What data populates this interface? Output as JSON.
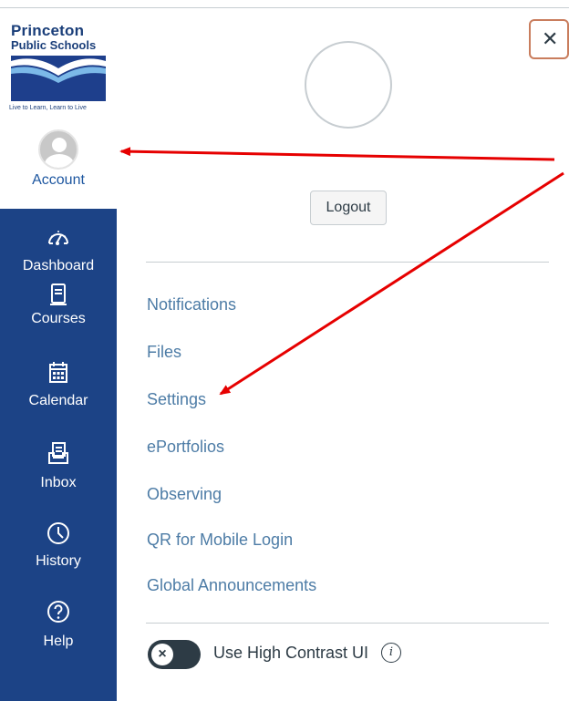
{
  "logo": {
    "line1": "Princeton",
    "line2": "Public Schools",
    "tagline": "Live to Learn, Learn to Live"
  },
  "account": {
    "label": "Account"
  },
  "nav": [
    {
      "label": "Dashboard",
      "icon": "dashboard-icon"
    },
    {
      "label": "Courses",
      "icon": "courses-icon"
    },
    {
      "label": "Calendar",
      "icon": "calendar-icon"
    },
    {
      "label": "Inbox",
      "icon": "inbox-icon"
    },
    {
      "label": "History",
      "icon": "history-icon"
    },
    {
      "label": "Help",
      "icon": "help-icon"
    }
  ],
  "tray": {
    "close_icon": "close-icon",
    "logout_label": "Logout",
    "links": [
      "Notifications",
      "Files",
      "Settings",
      "ePortfolios",
      "Observing",
      "QR for Mobile Login",
      "Global Announcements"
    ],
    "high_contrast_label": "Use High Contrast UI",
    "toggle_glyph": "×",
    "info_glyph": "i"
  },
  "colors": {
    "nav_background": "#1c4386",
    "link": "#4d7ca6",
    "account_text": "#1e57a0",
    "annotation_arrow": "#e60000",
    "close_border": "#c97d5d"
  }
}
